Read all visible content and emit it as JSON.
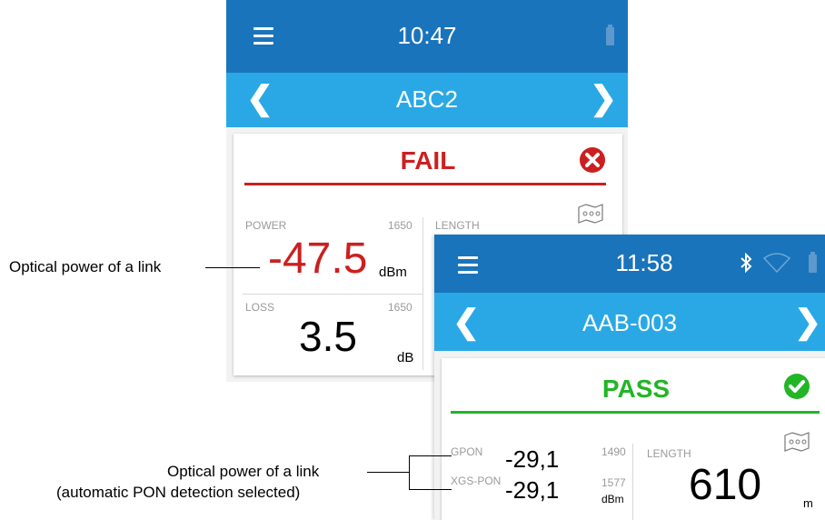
{
  "screen1": {
    "time": "10:47",
    "nav_title": "ABC2",
    "status": "FAIL",
    "power_label": "POWER",
    "power_wavelength": "1650",
    "power_value": "-47.5",
    "power_unit": "dBm",
    "loss_label": "LOSS",
    "loss_wavelength": "1650",
    "loss_value": "3.5",
    "loss_unit": "dB",
    "length_label": "LENGTH"
  },
  "screen2": {
    "time": "11:58",
    "nav_title": "AAB-003",
    "status": "PASS",
    "gpon_label": "GPON",
    "gpon_value": "-29,1",
    "gpon_wavelength": "1490",
    "xgs_label": "XGS-PON",
    "xgs_value": "-29,1",
    "xgs_wavelength": "1577",
    "power_unit": "dBm",
    "length_label": "LENGTH",
    "length_value": "610",
    "length_unit": "m"
  },
  "callouts": {
    "optical_power": "Optical power of a link",
    "optical_power_pon_line1": "Optical power of a link",
    "optical_power_pon_line2": "(automatic PON detection selected)"
  },
  "colors": {
    "topbar": "#1a74bb",
    "navbar": "#2aa8e6",
    "fail": "#cc1f1f",
    "pass": "#22b526"
  },
  "icons": [
    "menu-icon",
    "battery-icon",
    "chevron-left-icon",
    "chevron-right-icon",
    "fail-icon",
    "pass-icon",
    "map-icon",
    "bluetooth-icon",
    "wifi-icon"
  ]
}
